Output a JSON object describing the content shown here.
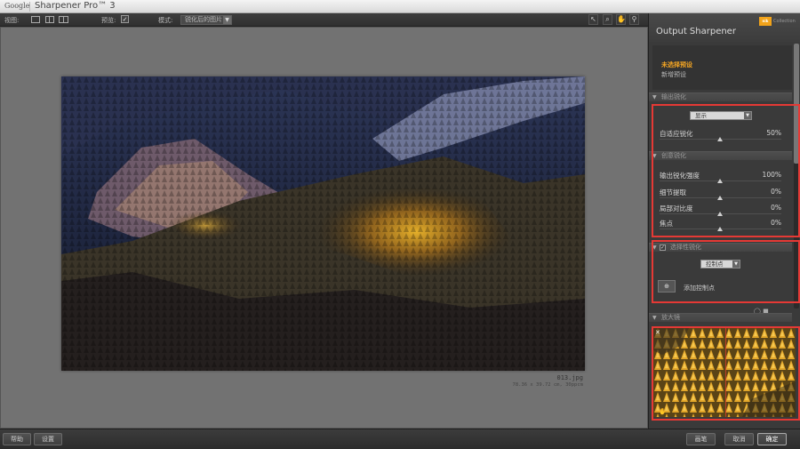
{
  "titlebar": {
    "brand": "Google",
    "app_title": "Sharpener Pro™ 3"
  },
  "toolbar": {
    "view_label": "视图:",
    "preview_label": "预览:",
    "preview_checked": "✓",
    "mode_label": "模式:",
    "mode_value": "锐化后的图片"
  },
  "photo": {
    "file_name": "013.jpg",
    "file_meta": "78.36 x 39.72 cm, 30ppcm"
  },
  "panel": {
    "title": "Output Sharpener",
    "logo_text": "nik",
    "logo_caption": "Collection",
    "preset_active": "未选择预设",
    "preset_new": "新增预设",
    "output_section": "输出锐化",
    "display_dropdown": "显示",
    "adaptive_label": "自适应锐化",
    "adaptive_value": "50%",
    "creative_section": "创意锐化",
    "params": [
      {
        "label": "输出锐化强度",
        "value": "100%"
      },
      {
        "label": "细节提取",
        "value": "0%"
      },
      {
        "label": "局部对比度",
        "value": "0%"
      },
      {
        "label": "焦点",
        "value": "0%"
      }
    ],
    "selective_section": "选择性锐化",
    "control_dropdown": "控制点",
    "add_control_point": "添加控制点",
    "loupe_section": "放大镜"
  },
  "bottom": {
    "help": "帮助",
    "settings": "设置",
    "brush": "画笔",
    "cancel": "取消",
    "ok": "确定"
  },
  "icons": [
    "arrow-icon",
    "zoom-icon",
    "hand-icon",
    "pin-icon",
    "close-icon"
  ]
}
